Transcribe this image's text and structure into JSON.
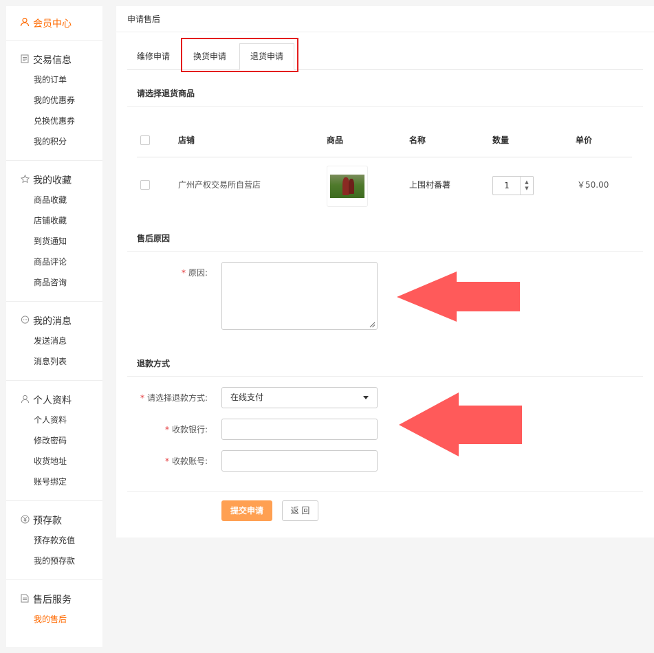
{
  "sidebar": {
    "top": {
      "label": "会员中心",
      "icon": "user-icon"
    },
    "groups": [
      {
        "title": "交易信息",
        "icon": "document-icon",
        "items": [
          "我的订单",
          "我的优惠券",
          "兑换优惠券",
          "我的积分"
        ]
      },
      {
        "title": "我的收藏",
        "icon": "star-icon",
        "items": [
          "商品收藏",
          "店铺收藏",
          "到货通知",
          "商品评论",
          "商品咨询"
        ]
      },
      {
        "title": "我的消息",
        "icon": "message-icon",
        "items": [
          "发送消息",
          "消息列表"
        ]
      },
      {
        "title": "个人资料",
        "icon": "user-icon",
        "items": [
          "个人资料",
          "修改密码",
          "收货地址",
          "账号绑定"
        ]
      },
      {
        "title": "预存款",
        "icon": "yen-icon",
        "items": [
          "预存款充值",
          "我的预存款"
        ]
      },
      {
        "title": "售后服务",
        "icon": "document-icon",
        "items": [
          "我的售后"
        ],
        "active_item": "我的售后"
      }
    ]
  },
  "main": {
    "title": "申请售后",
    "tabs": [
      "维修申请",
      "换货申请",
      "退货申请"
    ],
    "active_tab": "退货申请"
  },
  "product_section": {
    "title": "请选择退货商品",
    "headers": {
      "shop": "店铺",
      "product": "商品",
      "name": "名称",
      "qty": "数量",
      "price": "单价"
    },
    "row": {
      "shop": "广州产权交易所自营店",
      "name": "上围村番薯",
      "qty": "1",
      "price": "￥50.00"
    }
  },
  "reason_section": {
    "title": "售后原因",
    "reason_label": "原因:"
  },
  "refund_section": {
    "title": "退款方式",
    "method_label": "请选择退款方式:",
    "method_value": "在线支付",
    "bank_label": "收款银行:",
    "account_label": "收款账号:"
  },
  "buttons": {
    "submit": "提交申请",
    "back": "返 回"
  },
  "colors": {
    "accent": "#ff6a00",
    "submit": "#ffa052",
    "highlight_box": "#e31d1d",
    "arrow": "#ff5a5a"
  }
}
